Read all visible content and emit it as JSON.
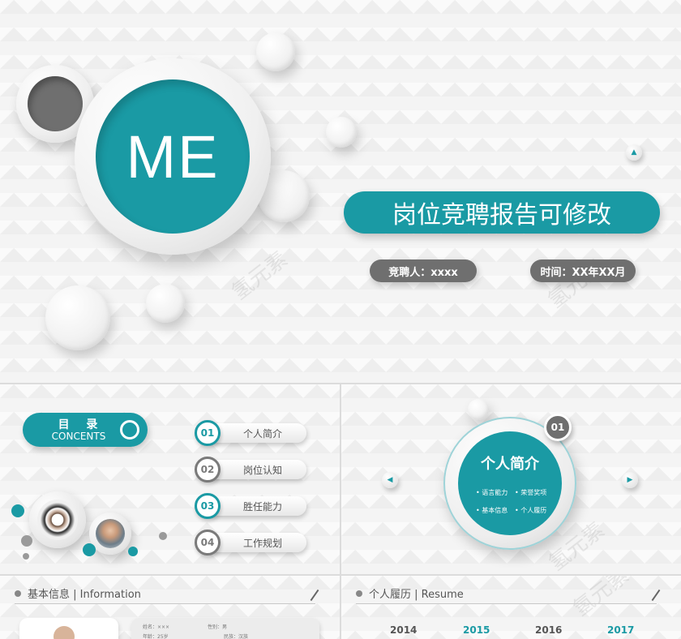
{
  "cover": {
    "me_text": "ME",
    "title": "岗位竞聘报告可修改",
    "applicant": "竞聘人：xxxx",
    "time": "时间：XX年XX月"
  },
  "toc": {
    "title": "目 录",
    "subtitle": "CONCENTS",
    "items": [
      {
        "num": "01",
        "label": "个人简介"
      },
      {
        "num": "02",
        "label": "岗位认知"
      },
      {
        "num": "03",
        "label": "胜任能力"
      },
      {
        "num": "04",
        "label": "工作规划"
      }
    ]
  },
  "section": {
    "badge": "01",
    "title": "个人简介",
    "items": [
      "语言能力",
      "荣誉奖项",
      "基本信息",
      "个人履历"
    ]
  },
  "basic_info": {
    "header": "基本信息 | Information",
    "fields": [
      "姓名：×××",
      "性别：男",
      "年龄：25岁",
      "民族：汉族"
    ]
  },
  "resume": {
    "header": "个人履历 | Resume",
    "years": [
      "2014",
      "2015",
      "2016",
      "2017"
    ]
  },
  "colors": {
    "accent": "#1a9aa4",
    "grey": "#6f6f6f"
  }
}
